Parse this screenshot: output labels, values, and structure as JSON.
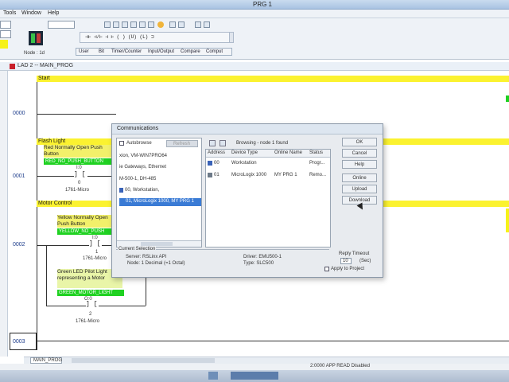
{
  "app": {
    "title": "PRG 1",
    "menus": [
      "Tools",
      "Window",
      "Help"
    ]
  },
  "toolbar": {
    "node_label": "Node : 1d",
    "tabs": [
      "User",
      "Bit",
      "Timer/Counter",
      "Input/Output",
      "Compare",
      "Comput"
    ]
  },
  "ladder": {
    "window_title": "LAD 2 -- MAIN_PROG",
    "rungs": [
      {
        "number": "0000",
        "title": "Start"
      },
      {
        "number": "0001",
        "title": "Flash Light"
      },
      {
        "number": "0002",
        "title": "Motor Control"
      },
      {
        "number": "0003",
        "title": ""
      }
    ],
    "red_note": "Red Normally Open Push Button",
    "red_tag": "RED_NO_PUSH_BUTTON",
    "yellow_note": "Yellow Normally Open Push Button",
    "yellow_tag": "YELLOW_NO_PUSH",
    "green_note": "Green LED Pilot Light representing a Motor",
    "green_tag": "GREEN_MOTOR_LIGHT",
    "addr_red": "I:0",
    "addr_red_bit": "0",
    "addr_red_dev": "1761-Micro",
    "addr_yellow": "I:0",
    "addr_yellow_bit": "1",
    "addr_yellow_dev": "1761-Micro",
    "addr_green": "O:0",
    "addr_green_bit": "2",
    "addr_green_dev": "1761-Micro",
    "bottom_tab": "MAIN_PROG",
    "status_right": "2:0000   APP  READ  Disabled"
  },
  "dialog": {
    "title": "Communications",
    "autobrowse_label": "Autobrowse",
    "refresh_label": "Refresh",
    "browsing_text": "Browsing - node 1 found",
    "tree_items": [
      "xion, VM-WIN7PRO64",
      "ie Gateways, Ethernet",
      "M-500-1, DH-485",
      "00, Workstation,",
      "01, MicroLogix 1000, MY PRG 1"
    ],
    "columns": [
      "Address",
      "Device Type",
      "Online Name",
      "Status"
    ],
    "rows": [
      {
        "address": "00",
        "device": "Workstation",
        "name": "",
        "status": "Progr..."
      },
      {
        "address": "01",
        "device": "MicroLogix 1000",
        "name": "MY PRG 1",
        "status": "Remo..."
      }
    ],
    "buttons": [
      "OK",
      "Cancel",
      "Help",
      "Online",
      "Upload",
      "Download"
    ],
    "current_selection_label": "Current Selection",
    "server_text": "Server: RSLinx API",
    "node_text": "Node:  1     Decimal (=1 Octal)",
    "driver_text": "Driver: EMU500-1",
    "type_text": "Type: SLC500",
    "reply_timeout_label": "Reply Timeout",
    "reply_timeout_value": "10",
    "reply_timeout_unit": "(Sec)",
    "apply_label": "Apply to Project"
  },
  "colors": {
    "rung_bar": "#fbf230",
    "tag_green": "#1fd121",
    "selection": "#3a7bd5"
  }
}
